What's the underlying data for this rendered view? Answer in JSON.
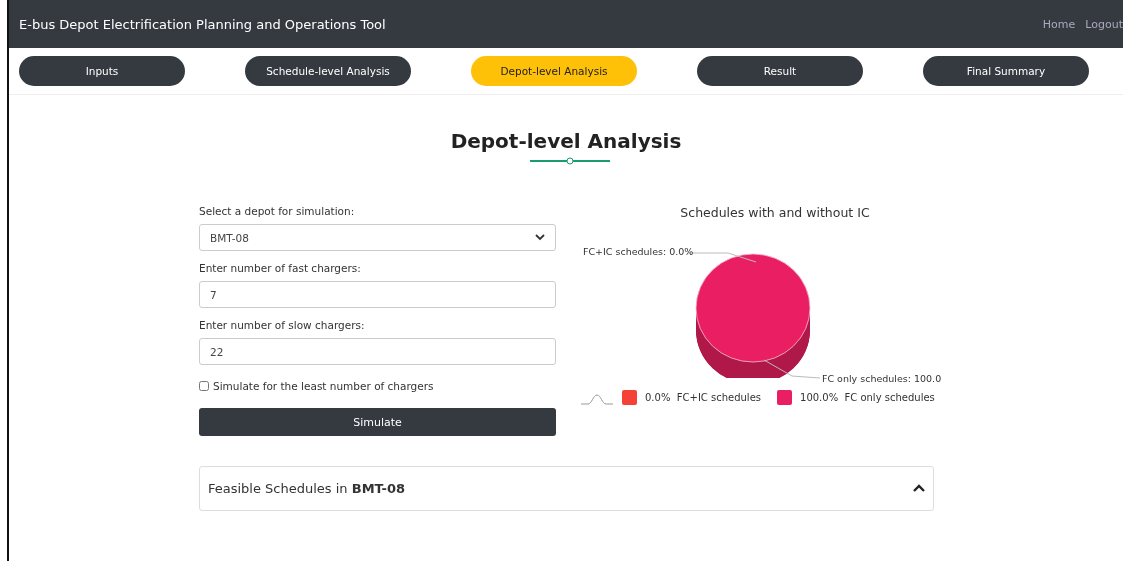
{
  "header": {
    "title": "E-bus Depot Electrification Planning and Operations Tool",
    "links": [
      "Home",
      "Logout"
    ]
  },
  "tabs": [
    {
      "label": "Inputs",
      "selected": false
    },
    {
      "label": "Schedule-level Analysis",
      "selected": false
    },
    {
      "label": "Depot-level Analysis",
      "selected": true
    },
    {
      "label": "Result",
      "selected": false
    },
    {
      "label": "Final Summary",
      "selected": false
    }
  ],
  "page_title": "Depot-level Analysis",
  "form": {
    "depot_label": "Select a depot for simulation:",
    "depot_value": "BMT-08",
    "fast_label": "Enter number of fast chargers:",
    "fast_value": "7",
    "slow_label": "Enter number of slow chargers:",
    "slow_value": "22",
    "least_checkbox": {
      "label": "Simulate for the least number of chargers",
      "checked": false
    },
    "button": "Simulate"
  },
  "chart": {
    "chart_data": {
      "type": "pie",
      "title": "Schedules with and without IC",
      "categories": [
        "FC+IC schedules",
        "FC only schedules"
      ],
      "values": [
        0.0,
        100.0
      ]
    },
    "slice_labels": [
      "FC+IC schedules: 0.0%",
      "FC only schedules: 100.0"
    ],
    "legend": [
      {
        "percent": "0.0%",
        "color": "#f44336"
      },
      {
        "percent": "100.0%",
        "color": "#e91e63"
      }
    ]
  },
  "accordion": {
    "title": "Feasible Schedules in **BMT-08**",
    "expanded": true
  }
}
